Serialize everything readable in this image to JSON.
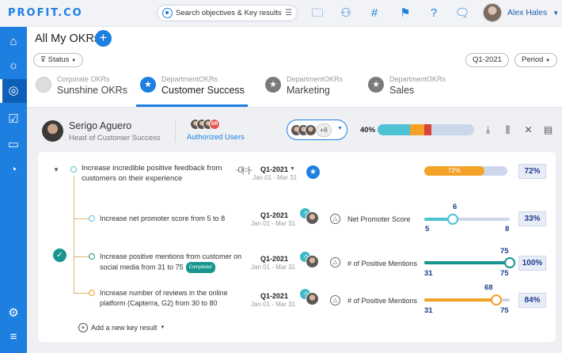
{
  "app": {
    "logo": "PROFIT.CO"
  },
  "topbar": {
    "search_placeholder": "Search objectives & Key results",
    "user_name": "Alex Hales"
  },
  "sidebar": {
    "items": [
      "home-icon",
      "bulb-icon",
      "target-icon",
      "calendar-check-icon",
      "chat-icon",
      "gauge-icon",
      "settings-icon",
      "sliders-icon"
    ],
    "active": "target-icon"
  },
  "header": {
    "title": "All My OKRs",
    "status_filter": "Status",
    "period_value": "Q1-2021",
    "period_label": "Period"
  },
  "tabs": [
    {
      "sub": "Corporate OKRs",
      "label": "Sunshine OKRs",
      "active": false
    },
    {
      "sub": "DepartmentOKRs",
      "label": "Customer Success",
      "active": true
    },
    {
      "sub": "DepartmentOKRs",
      "label": "Marketing",
      "active": false
    },
    {
      "sub": "DepartmentOKRs",
      "label": "Sales",
      "active": false
    }
  ],
  "owner": {
    "name": "Serigo Aguero",
    "role": "Head of Customer Success",
    "authorized_initials": "SR",
    "authorized_label": "Authorized Users",
    "team_more": "+6",
    "progress_pct": "40%",
    "progress_segments": [
      {
        "fraction": 0.34,
        "color": "#4fc2d4"
      },
      {
        "fraction": 0.14,
        "color": "#f4a128"
      },
      {
        "fraction": 0.08,
        "color": "#d6433b"
      }
    ]
  },
  "objective": {
    "title": "Increase incredible positive feedback from customers on their experience",
    "period": "Q1-2021",
    "range": "Jan 01 - Mar 31",
    "progress": 0.72,
    "progress_label": "72%",
    "pct": "72%"
  },
  "key_results": [
    {
      "title": "Increase net promoter score from 5 to 8",
      "completed": "",
      "period": "Q1-2021",
      "range": "Jan 01 - Mar 31",
      "metric": "Net Promoter Score",
      "start": "5",
      "target": "8",
      "current": "6",
      "progress": 0.33,
      "pct": "33%",
      "color": "#4fc2d4"
    },
    {
      "title": "Increase positive mentions from customer on social media from 31 to 75",
      "completed": "Completed",
      "period": "Q1-2021",
      "range": "Jan 01 - Mar 31",
      "metric": "# of Positive Mentions",
      "start": "31",
      "target": "75",
      "current": "75",
      "progress": 1.0,
      "pct": "100%",
      "color": "#17958e"
    },
    {
      "title": "Increase number of reviews in the online platform (Capterra, G2) from 30 to 80",
      "completed": "",
      "period": "Q1-2021",
      "range": "Jan 01 - Mar 31",
      "metric": "# of Positive Mentions",
      "start": "31",
      "target": "75",
      "current": "68",
      "progress": 0.84,
      "pct": "84%",
      "color": "#f4a128"
    }
  ],
  "add_key_result": "Add a new key result"
}
